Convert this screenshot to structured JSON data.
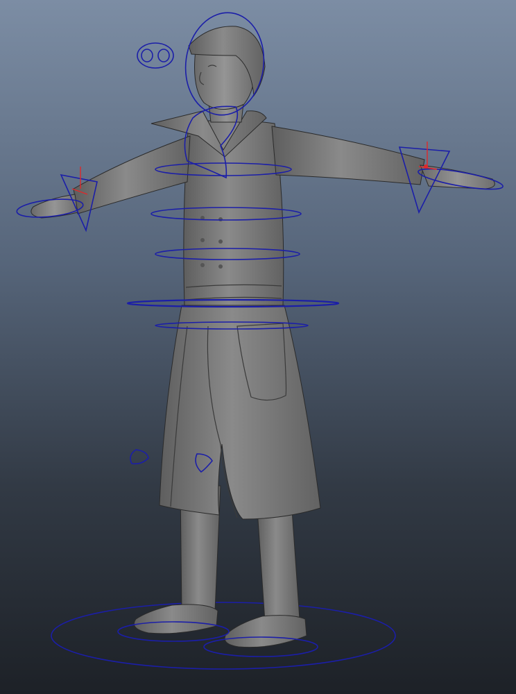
{
  "viewport": {
    "description_name": "maya-perspective-viewport",
    "background_top": "#7c8da4",
    "background_bottom": "#1d2127",
    "model_color": "#7b7b7b",
    "control_curve_color": "#1b1ea8",
    "locator_color": "#e0282a"
  },
  "rig": {
    "controls": [
      "head-control",
      "eye-aim-control",
      "neck-control",
      "chest-control",
      "spine-upper-control",
      "spine-lower-control",
      "cog-control",
      "hip-control",
      "left-wrist-ik-control",
      "right-wrist-ik-control",
      "left-knee-pole-control",
      "right-knee-pole-control",
      "global-root-control",
      "left-foot-control",
      "right-foot-control"
    ]
  }
}
